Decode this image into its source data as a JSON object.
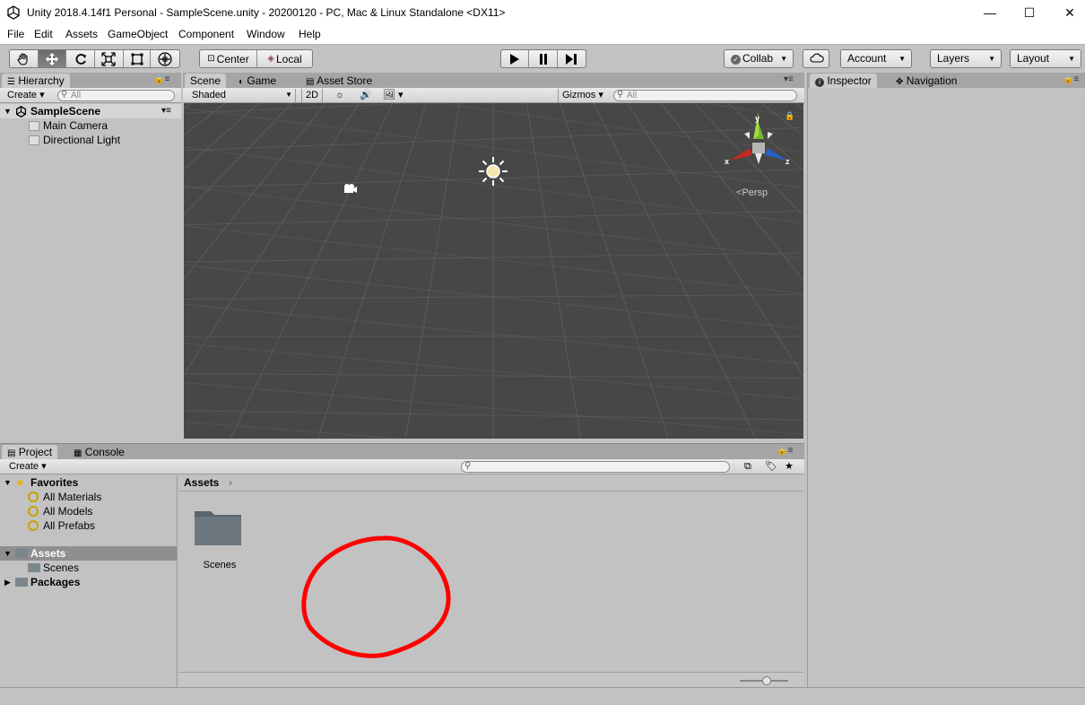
{
  "window": {
    "title": "Unity 2018.4.14f1 Personal - SampleScene.unity - 20200120 - PC, Mac & Linux Standalone <DX11>",
    "minimize": "—",
    "maximize": "☐",
    "close": "✕"
  },
  "menu": [
    "File",
    "Edit",
    "Assets",
    "GameObject",
    "Component",
    "Window",
    "Help"
  ],
  "toolbar": {
    "tools": [
      "hand-tool",
      "move-tool",
      "rotate-tool",
      "scale-tool",
      "rect-tool",
      "transform-tool"
    ],
    "pivot_mode": "Center",
    "pivot_rotation": "Local",
    "play": "▶",
    "pause": "❚❚",
    "step": "▶|",
    "collab": "Collab",
    "account": "Account",
    "layers": "Layers",
    "layout": "Layout"
  },
  "hierarchy": {
    "tab": "Hierarchy",
    "create": "Create",
    "search_placeholder": "All",
    "scene": "SampleScene",
    "items": [
      "Main Camera",
      "Directional Light"
    ]
  },
  "scene": {
    "tabs": [
      "Scene",
      "Game",
      "Asset Store"
    ],
    "shading": "Shaded",
    "mode_2d": "2D",
    "gizmos": "Gizmos",
    "search_placeholder": "All",
    "persp": "Persp",
    "axis_x": "x",
    "axis_y": "y",
    "axis_z": "z"
  },
  "inspector": {
    "tabs": [
      "Inspector",
      "Navigation"
    ]
  },
  "project": {
    "tabs": [
      "Project",
      "Console"
    ],
    "create": "Create",
    "favorites": "Favorites",
    "favorite_items": [
      "All Materials",
      "All Models",
      "All Prefabs"
    ],
    "assets": "Assets",
    "asset_children": [
      "Scenes"
    ],
    "packages": "Packages",
    "breadcrumb": "Assets",
    "files": [
      "Scenes"
    ]
  },
  "colors": {
    "annotation": "#ff0000",
    "scene_bg": "#474747",
    "panel_bg": "#c2c2c2"
  }
}
